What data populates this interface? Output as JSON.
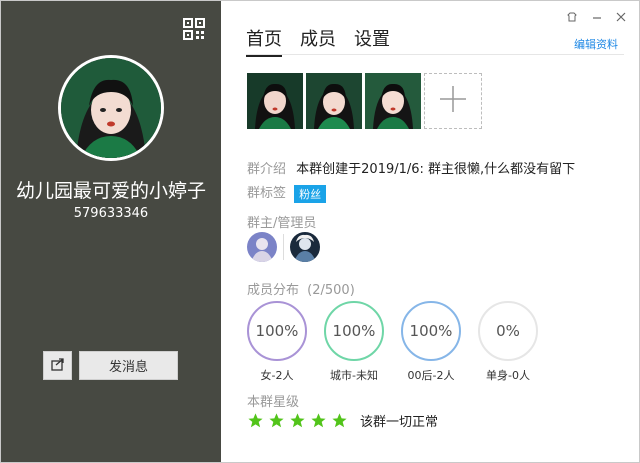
{
  "colors": {
    "left_bg": "#474942",
    "accent": "#1aa3e8",
    "star": "#52c41a"
  },
  "left": {
    "group_name": "幼儿园最可爱的小婷子",
    "group_id": "579633346",
    "send_button": "发消息",
    "share_icon": "share-icon",
    "qr_icon": "qr-code-icon"
  },
  "window_controls": {
    "skin": "skin-icon",
    "minimize": "minimize-icon",
    "close": "close-icon"
  },
  "tabs": [
    {
      "label": "首页",
      "active": true
    },
    {
      "label": "成员",
      "active": false
    },
    {
      "label": "设置",
      "active": false
    }
  ],
  "edit_link": "编辑资料",
  "intro": {
    "label": "群介绍",
    "text": "本群创建于2019/1/6:  群主很懒,什么都没有留下"
  },
  "tags": {
    "label": "群标签",
    "tag": "粉丝"
  },
  "admins": {
    "label": "群主/管理员"
  },
  "distribution": {
    "title": "成员分布",
    "count": "(2/500)",
    "items": [
      {
        "percent": "100%",
        "label": "女-2人",
        "color": "#a993d6"
      },
      {
        "percent": "100%",
        "label": "城市-未知",
        "color": "#6fd6a7"
      },
      {
        "percent": "100%",
        "label": "00后-2人",
        "color": "#86b6e8"
      },
      {
        "percent": "0%",
        "label": "单身-0人",
        "color": "#e6e6e6"
      }
    ]
  },
  "level": {
    "title": "本群星级",
    "stars": 5,
    "text": "该群一切正常"
  }
}
